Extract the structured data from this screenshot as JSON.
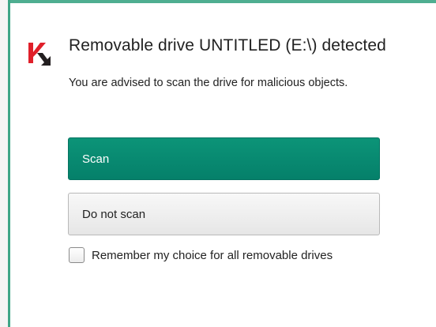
{
  "dialog": {
    "title": "Removable drive UNTITLED (E:\\) detected",
    "message": "You are advised to scan the drive for malicious objects.",
    "logo_icon": "kaspersky-k-logo",
    "accent_color": "#078a70",
    "logo_color": "#e0202a"
  },
  "actions": {
    "scan_label": "Scan",
    "no_scan_label": "Do not scan"
  },
  "remember": {
    "label": "Remember my choice for all removable drives",
    "checked": false
  }
}
